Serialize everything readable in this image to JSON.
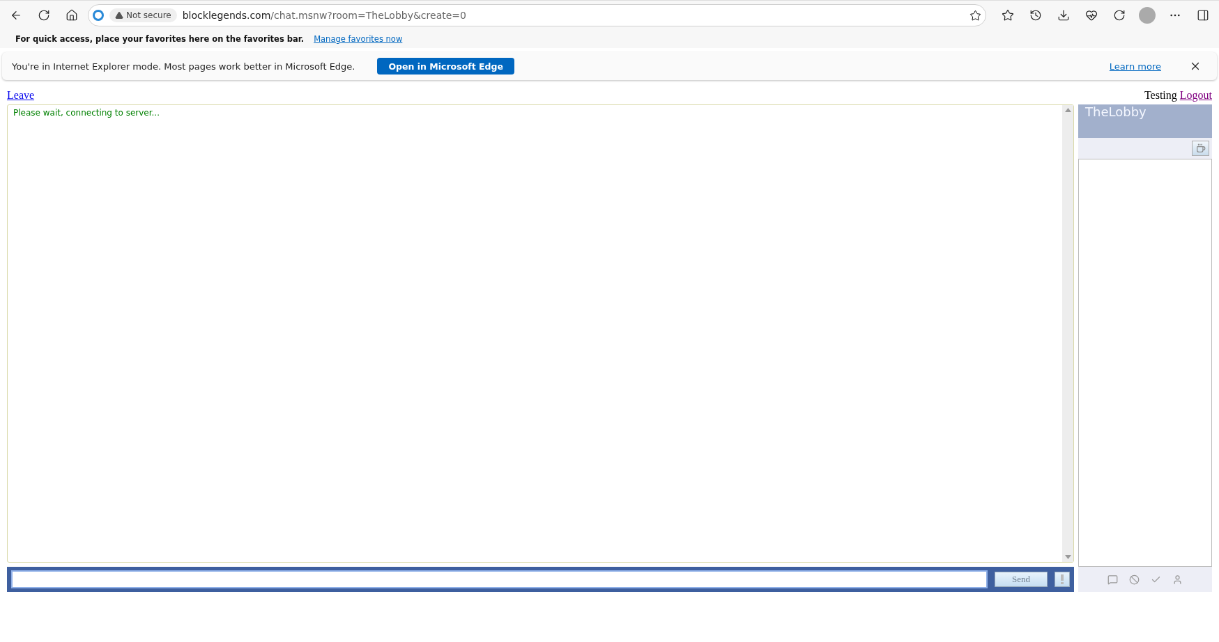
{
  "browser": {
    "security": "Not secure",
    "url_host": "blocklegends.com",
    "url_path": "/chat.msnw?room=TheLobby&create=0"
  },
  "favorites_bar": {
    "message": "For quick access, place your favorites here on the favorites bar.",
    "link": "Manage favorites now"
  },
  "ie_banner": {
    "message": "You're in Internet Explorer mode. Most pages work better in Microsoft Edge.",
    "button": "Open in Microsoft Edge",
    "link": "Learn more"
  },
  "page": {
    "leave": "Leave",
    "user": "Testing",
    "logout": "Logout",
    "status_message": "Please wait, connecting to server...",
    "room_name": "TheLobby",
    "send_button": "Send"
  }
}
